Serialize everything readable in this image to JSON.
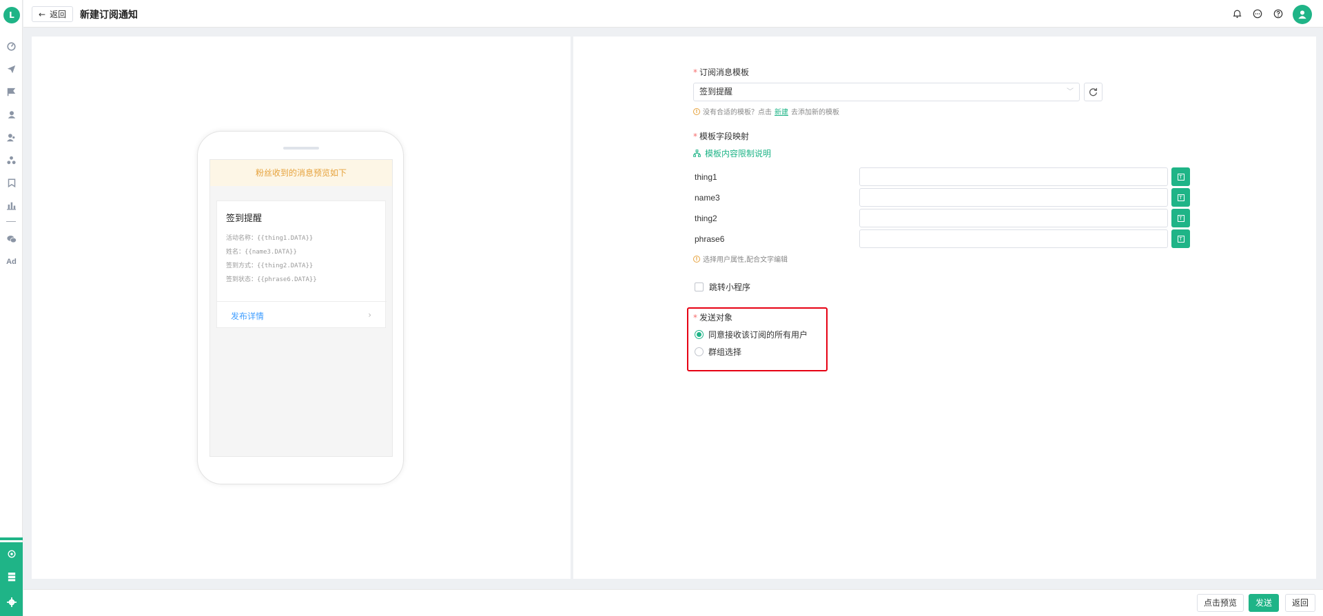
{
  "header": {
    "back_label": "返回",
    "title": "新建订阅通知"
  },
  "sidebar": {
    "logo_text": "L",
    "items": [
      "dashboard-icon",
      "send-icon",
      "flag-icon",
      "user-icon",
      "user-group-icon",
      "cluster-icon",
      "bookmark-icon",
      "bar-chart-icon",
      "wechat-icon"
    ],
    "ad_label": "Ad",
    "bottom_items": [
      "settings-gear-icon",
      "database-icon",
      "gear-icon"
    ]
  },
  "preview": {
    "banner": "粉丝收到的消息预览如下",
    "card_title": "签到提醒",
    "lines": [
      "活动名称：{{thing1.DATA}}",
      "姓名：{{name3.DATA}}",
      "签到方式：{{thing2.DATA}}",
      "签到状态：{{phrase6.DATA}}"
    ],
    "link_label": "发布详情",
    "link_chevron": "›"
  },
  "form": {
    "template_label": "订阅消息模板",
    "template_value": "签到提醒",
    "template_hint_prefix": "没有合适的模板？点击",
    "template_hint_link": "新建",
    "template_hint_suffix": "去添加新的模板",
    "mapping_label": "模板字段映射",
    "mapping_link": "模板内容限制说明",
    "fields": [
      {
        "label": "thing1",
        "value": ""
      },
      {
        "label": "name3",
        "value": ""
      },
      {
        "label": "thing2",
        "value": ""
      },
      {
        "label": "phrase6",
        "value": ""
      }
    ],
    "fields_hint": "选择用户属性,配合文字编辑",
    "miniprogram_label": "跳转小程序",
    "target_label": "发送对象",
    "target_options": [
      "同意接收该订阅的所有用户",
      "群组选择"
    ],
    "target_selected": 0
  },
  "footer": {
    "preview_label": "点击预览",
    "send_label": "发送",
    "back_label": "返回"
  },
  "colors": {
    "accent": "#1fb487",
    "warning": "#e6a23c",
    "highlight": "#e60012",
    "link": "#409eff"
  }
}
